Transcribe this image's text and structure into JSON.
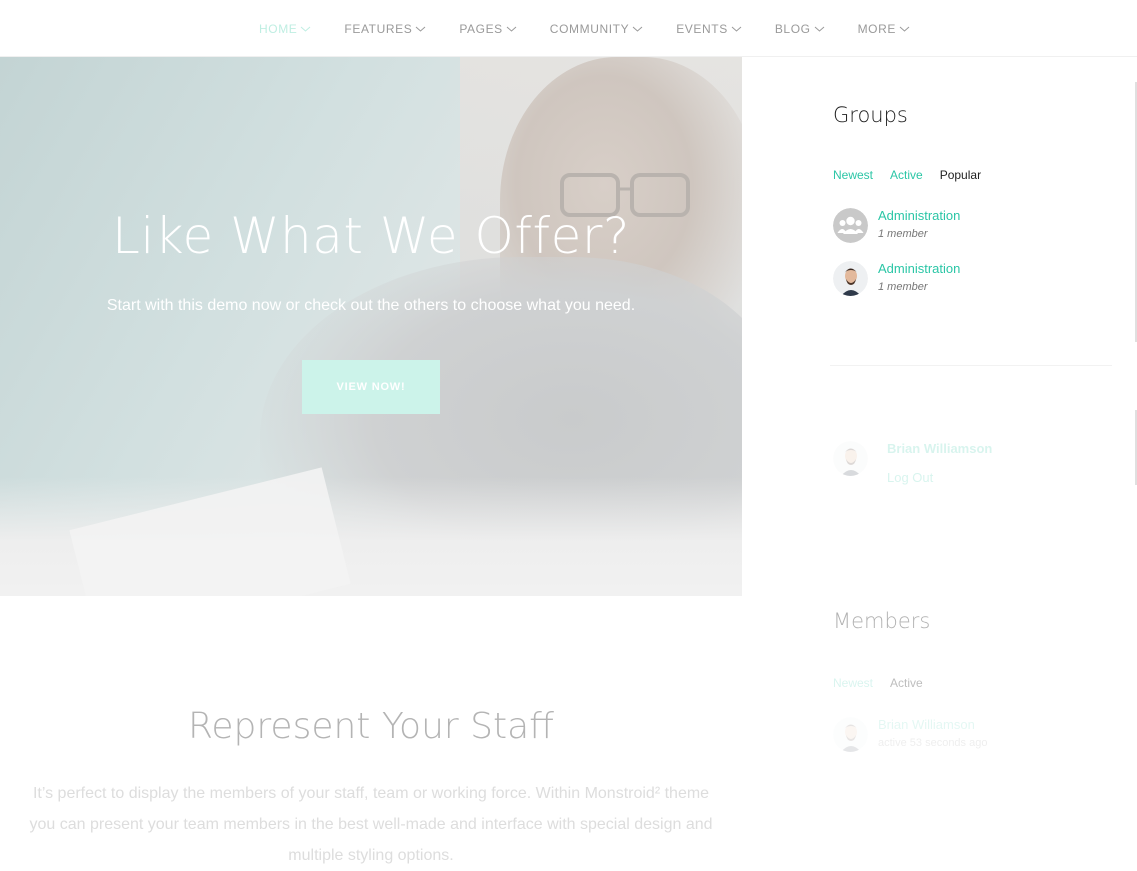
{
  "nav": {
    "items": [
      {
        "label": "HOME",
        "active": true
      },
      {
        "label": "FEATURES",
        "active": false
      },
      {
        "label": "PAGES",
        "active": false
      },
      {
        "label": "COMMUNITY",
        "active": false
      },
      {
        "label": "EVENTS",
        "active": false
      },
      {
        "label": "BLOG",
        "active": false
      },
      {
        "label": "MORE",
        "active": false
      }
    ]
  },
  "hero": {
    "title": "Like What We Offer?",
    "subtitle": "Start with this demo now or check out the others to choose what you need.",
    "button_label": "VIEW NOW!"
  },
  "staff": {
    "title": "Represent Your Staff",
    "text": "It’s perfect to display the members of your staff, team or working force. Within Monstroid² theme you can present your team members in the best well-made and interface with special design and multiple styling options."
  },
  "groups": {
    "title": "Groups",
    "tabs": [
      "Newest",
      "Active",
      "Popular"
    ],
    "items": [
      {
        "name": "Administration",
        "meta": "1 member"
      },
      {
        "name": "Administration",
        "meta": "1 member"
      }
    ]
  },
  "account": {
    "user_name": "Brian Williamson",
    "logout_label": "Log Out"
  },
  "members": {
    "title": "Members",
    "tabs": [
      "Newest",
      "Active"
    ],
    "items": [
      {
        "name": "Brian Williamson",
        "meta": "active 53 seconds ago"
      }
    ]
  },
  "colors": {
    "accent": "#2bc6a6",
    "nav_active": "#bfeee2",
    "button_bg": "#ccf3ea"
  }
}
